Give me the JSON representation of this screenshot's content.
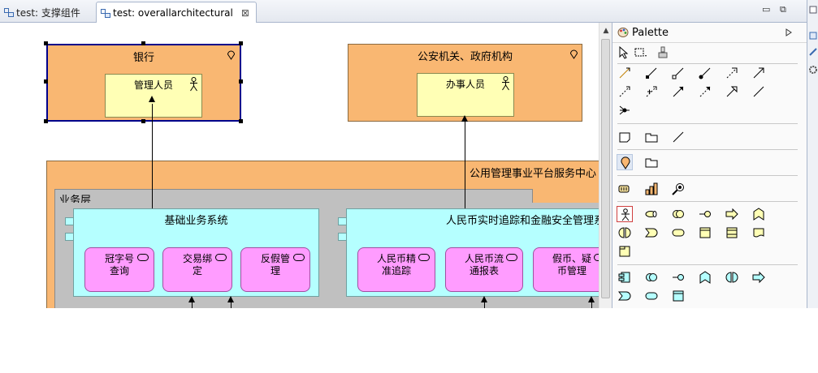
{
  "tabs": [
    {
      "label": "test: 支撑组件",
      "active": false
    },
    {
      "label": "test: overallarchitectural",
      "active": true,
      "close": "⊠"
    }
  ],
  "window_controls": {
    "minimize": "▭",
    "restore": "⧉"
  },
  "diagram": {
    "bank": {
      "title": "银行",
      "actor": "管理人员"
    },
    "police": {
      "title": "公安机关、政府机构",
      "actor": "办事人员"
    },
    "platform": {
      "title": "公用管理事业平台服务中心"
    },
    "business_layer": {
      "title": "业务层"
    },
    "basic_system": {
      "title": "基础业务系统",
      "services": [
        {
          "line1": "冠字号",
          "line2": "查询"
        },
        {
          "line1": "交易绑",
          "line2": "定"
        },
        {
          "line1": "反假管",
          "line2": "理"
        }
      ]
    },
    "rmb_system": {
      "title": "人民币实时追踪和金融安全管理系",
      "services": [
        {
          "line1": "人民币精",
          "line2": "准追踪"
        },
        {
          "line1": "人民币流",
          "line2": "通报表"
        },
        {
          "line1": "假币、疑",
          "line2": "币管理"
        }
      ]
    }
  },
  "palette": {
    "title": "Palette",
    "expand_icon": "triangle-right-icon"
  },
  "colors": {
    "location": "#f9b772",
    "actor": "#ffffb5",
    "application": "#b5ffff",
    "service": "#ff9cff",
    "layer": "#c0c0c0",
    "selection": "#00008b"
  }
}
